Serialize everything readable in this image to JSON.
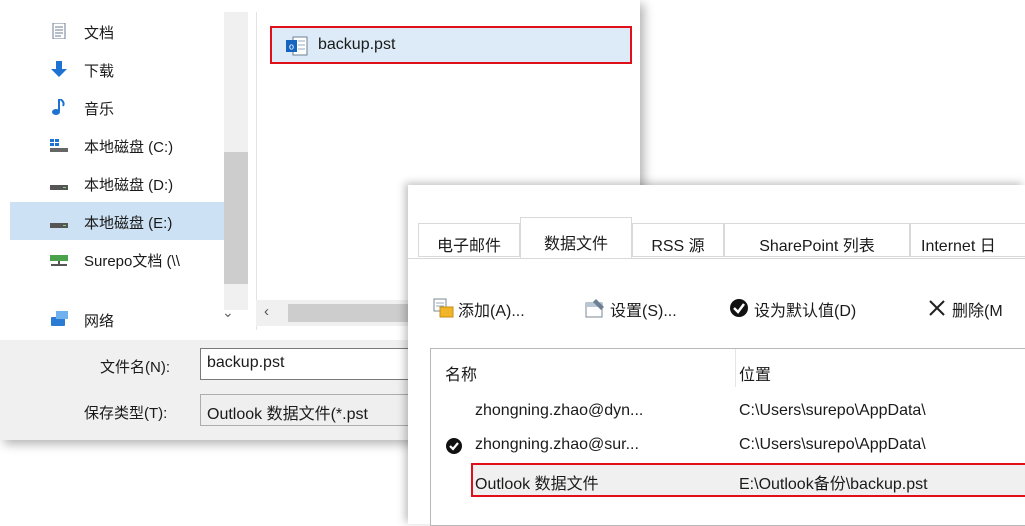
{
  "nav": {
    "items": [
      {
        "label": "文档",
        "icon": "document-icon"
      },
      {
        "label": "下载",
        "icon": "download-arrow-icon"
      },
      {
        "label": "音乐",
        "icon": "music-note-icon"
      },
      {
        "label": "本地磁盘 (C:)",
        "icon": "system-drive-icon"
      },
      {
        "label": "本地磁盘 (D:)",
        "icon": "drive-icon"
      },
      {
        "label": "本地磁盘 (E:)",
        "icon": "drive-icon",
        "selected": true
      },
      {
        "label": "Surepo文档 (\\\\",
        "icon": "network-drive-icon"
      },
      {
        "label": "网络",
        "icon": "network-icon"
      }
    ]
  },
  "files": [
    {
      "name": "backup.pst",
      "icon": "outlook-pst-icon"
    }
  ],
  "bottom": {
    "filename_label": "文件名(N):",
    "filename_value": "backup.pst",
    "filetype_label": "保存类型(T):",
    "filetype_value": "Outlook 数据文件(*.pst"
  },
  "account_settings": {
    "tabs": [
      "电子邮件",
      "数据文件",
      "RSS 源",
      "SharePoint 列表",
      "Internet 日"
    ],
    "active_tab": "数据文件",
    "toolbar": {
      "add": "添加(A)...",
      "settings": "设置(S)...",
      "set_default": "设为默认值(D)",
      "delete": "删除(M"
    },
    "columns": {
      "name": "名称",
      "location": "位置"
    },
    "rows": [
      {
        "name": "zhongning.zhao@dyn...",
        "location": "C:\\Users\\surepo\\AppData\\",
        "default": false
      },
      {
        "name": "zhongning.zhao@sur...",
        "location": "C:\\Users\\surepo\\AppData\\",
        "default": true
      },
      {
        "name": "Outlook 数据文件",
        "location": "E:\\Outlook备份\\backup.pst",
        "default": false
      }
    ]
  },
  "colors": {
    "highlight_red": "#e0101a",
    "selection_blue": "#cce1f3",
    "accent_blue": "#1e73d2"
  }
}
